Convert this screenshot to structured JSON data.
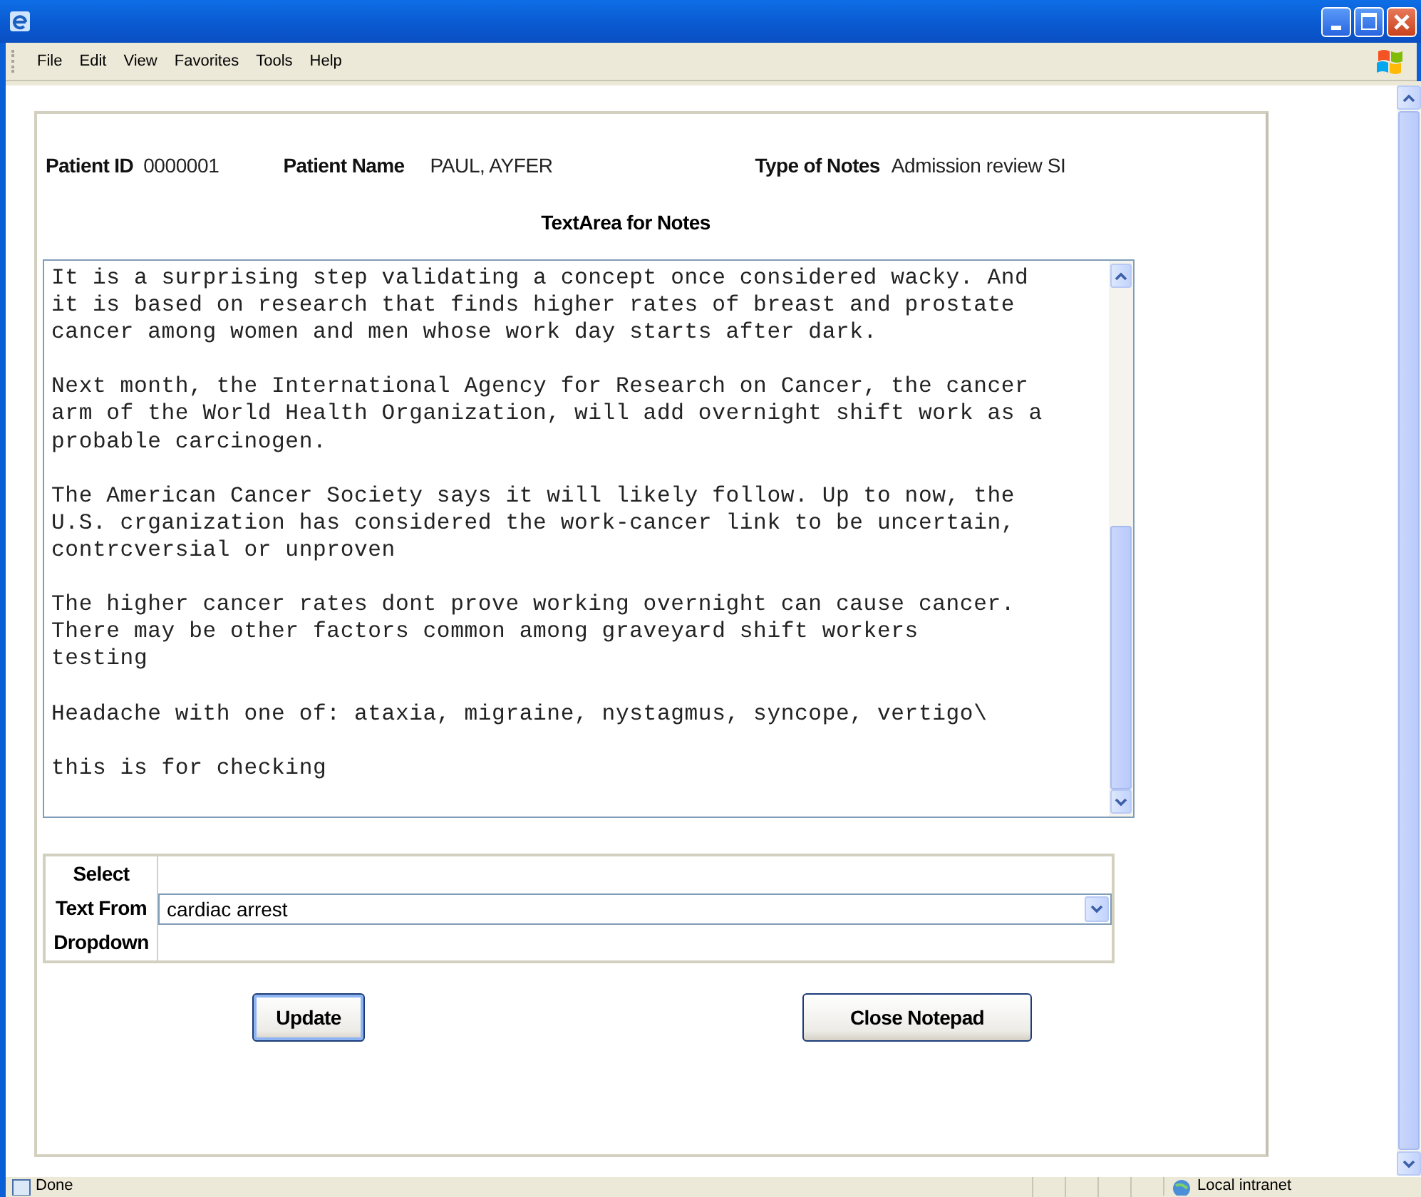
{
  "menu": [
    "File",
    "Edit",
    "View",
    "Favorites",
    "Tools",
    "Help"
  ],
  "header": [
    {
      "label": "Patient ID",
      "value": "0000001"
    },
    {
      "label": "Patient Name",
      "value": "PAUL, AYFER"
    },
    {
      "label": "Type of Notes",
      "value": "Admission review SI"
    }
  ],
  "notes": {
    "heading": "TextArea for Notes",
    "text": "It is a surprising step validating a concept once considered wacky. And\nit is based on research that finds higher rates of breast and prostate\ncancer among women and men whose work day starts after dark.\n\nNext month, the International Agency for Research on Cancer, the cancer\narm of the World Health Organization, will add overnight shift work as a\nprobable carcinogen.\n\nThe American Cancer Society says it will likely follow. Up to now, the\nU.S. crganization has considered the work-cancer link to be uncertain,\ncontrcversial or unproven\n\nThe higher cancer rates dont prove working overnight can cause cancer.\nThere may be other factors common among graveyard shift workers\ntesting\n\nHeadache with one of: ataxia, migraine, nystagmus, syncope, vertigo\\\n\nthis is for checking"
  },
  "select": {
    "label_lines": [
      "Select",
      "Text From",
      "Dropdown"
    ],
    "value": "cardiac arrest"
  },
  "buttons": [
    {
      "label": "Update",
      "default": true
    },
    {
      "label": "Close Notepad",
      "default": false
    }
  ],
  "status_bar": {
    "text": "Done",
    "zone": "Local intranet"
  }
}
